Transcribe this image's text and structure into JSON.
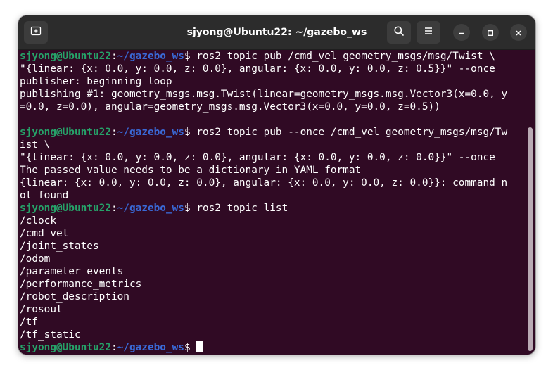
{
  "window": {
    "title": "sjyong@Ubuntu22: ~/gazebo_ws",
    "icons": {
      "new_tab": "new-tab-icon",
      "search": "search-icon",
      "menu": "hamburger-menu-icon",
      "minimize": "minimize-icon",
      "maximize": "maximize-icon",
      "close": "close-icon"
    }
  },
  "prompt": {
    "user_host": "sjyong@Ubuntu22",
    "colon": ":",
    "path": "~/gazebo_ws",
    "symbol": "$ "
  },
  "colors": {
    "terminal_bg": "#300a24",
    "titlebar_bg": "#2c2c2c",
    "prompt_user": "#26a269",
    "prompt_path": "#3a6ad8",
    "text": "#ffffff"
  },
  "terminal": {
    "lines": [
      {
        "prompt": true,
        "text": "ros2 topic pub /cmd_vel geometry_msgs/msg/Twist \\"
      },
      {
        "text": "\"{linear: {x: 0.0, y: 0.0, z: 0.0}, angular: {x: 0.0, y: 0.0, z: 0.5}}\" --once"
      },
      {
        "text": "publisher: beginning loop"
      },
      {
        "text": "publishing #1: geometry_msgs.msg.Twist(linear=geometry_msgs.msg.Vector3(x=0.0, y"
      },
      {
        "text": "=0.0, z=0.0), angular=geometry_msgs.msg.Vector3(x=0.0, y=0.0, z=0.5))"
      },
      {
        "text": ""
      },
      {
        "prompt": true,
        "text": "ros2 topic pub --once /cmd_vel geometry_msgs/msg/Tw"
      },
      {
        "text": "ist \\"
      },
      {
        "text": "\"{linear: {x: 0.0, y: 0.0, z: 0.0}, angular: {x: 0.0, y: 0.0, z: 0.0}}\" --once"
      },
      {
        "text": "The passed value needs to be a dictionary in YAML format"
      },
      {
        "text": "{linear: {x: 0.0, y: 0.0, z: 0.0}, angular: {x: 0.0, y: 0.0, z: 0.0}}: command n"
      },
      {
        "text": "ot found"
      },
      {
        "prompt": true,
        "text": "ros2 topic list"
      },
      {
        "text": "/clock"
      },
      {
        "text": "/cmd_vel"
      },
      {
        "text": "/joint_states"
      },
      {
        "text": "/odom"
      },
      {
        "text": "/parameter_events"
      },
      {
        "text": "/performance_metrics"
      },
      {
        "text": "/robot_description"
      },
      {
        "text": "/rosout"
      },
      {
        "text": "/tf"
      },
      {
        "text": "/tf_static"
      },
      {
        "prompt": true,
        "text": "",
        "cursor": true
      }
    ]
  }
}
